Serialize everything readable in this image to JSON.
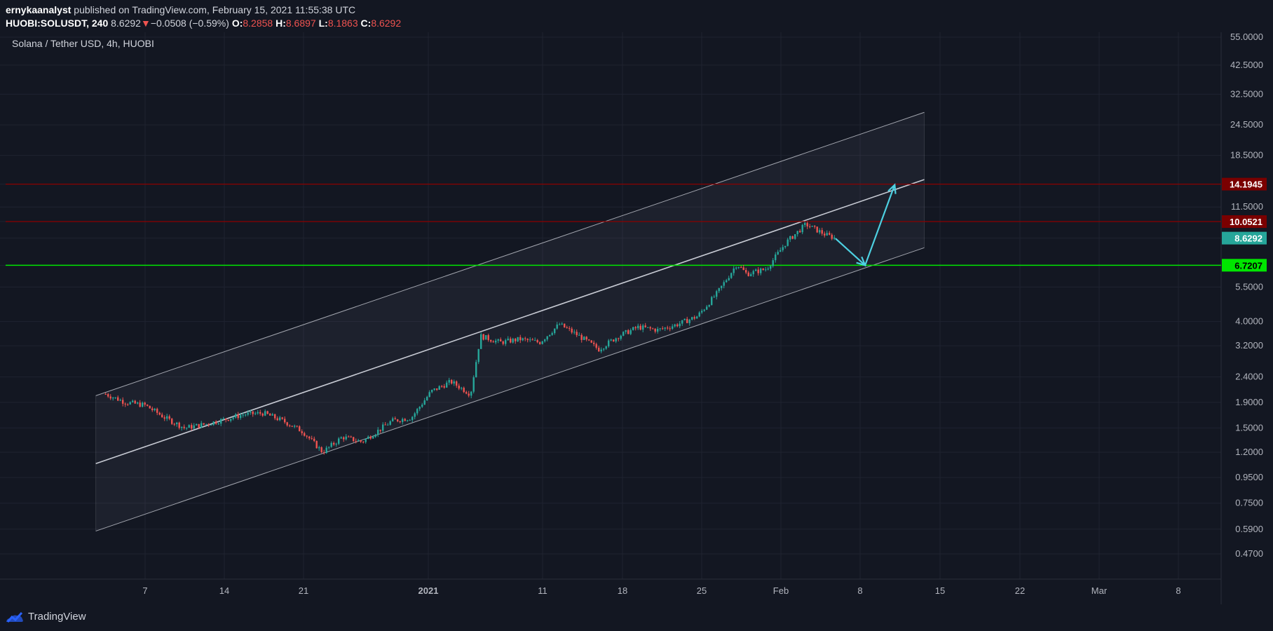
{
  "header": {
    "author": "ernykaanalyst",
    "published_text": "published on TradingView.com, February 15, 2021 11:55:38 UTC",
    "symbol": "HUOBI:SOLUSDT, 240",
    "last": "8.6292",
    "change": "−0.0508 (−0.59%)",
    "open_label": "O:",
    "open": "8.2858",
    "high_label": "H:",
    "high": "8.6897",
    "low_label": "L:",
    "low": "8.1863",
    "close_label": "C:",
    "close": "8.6292"
  },
  "footer": {
    "brand": "TradingView"
  },
  "colors": {
    "background": "#131722",
    "grid": "#1f2330",
    "up": "#26a69a",
    "down": "#ef5350",
    "channel": "#d1d4dc",
    "resistance": "#8b0000",
    "support": "#00e600",
    "arrow": "#4dd0e1"
  },
  "chart_data": {
    "type": "candlestick",
    "title": "Solana / Tether USD, 4h, HUOBI",
    "y_scale": "log",
    "ylim": [
      0.42,
      56
    ],
    "y_ticks": [
      "55.0000",
      "42.5000",
      "32.5000",
      "24.5000",
      "18.5000",
      "14.1945",
      "11.5000",
      "10.0521",
      "8.6292",
      "6.7207",
      "5.5000",
      "4.0000",
      "3.2000",
      "2.4000",
      "1.9000",
      "1.5000",
      "1.2000",
      "0.9500",
      "0.7500",
      "0.5900",
      "0.4700"
    ],
    "x_ticks": [
      "7",
      "14",
      "21",
      "2021",
      "11",
      "18",
      "25",
      "Feb",
      "8",
      "15",
      "22",
      "Mar",
      "8"
    ],
    "price_levels": [
      {
        "label": "14.1945",
        "value": 14.1945,
        "style": "resistance"
      },
      {
        "label": "10.0521",
        "value": 10.0521,
        "style": "resistance"
      },
      {
        "label": "8.6292",
        "value": 8.6292,
        "style": "last"
      },
      {
        "label": "6.7207",
        "value": 6.7207,
        "style": "support"
      }
    ],
    "price_path": [
      {
        "date": "2020-12-03",
        "close": 2.05
      },
      {
        "date": "2020-12-05",
        "close": 1.9
      },
      {
        "date": "2020-12-07",
        "close": 1.85
      },
      {
        "date": "2020-12-09",
        "close": 1.65
      },
      {
        "date": "2020-12-11",
        "close": 1.5
      },
      {
        "date": "2020-12-13",
        "close": 1.55
      },
      {
        "date": "2020-12-15",
        "close": 1.62
      },
      {
        "date": "2020-12-17",
        "close": 1.7
      },
      {
        "date": "2020-12-19",
        "close": 1.72
      },
      {
        "date": "2020-12-21",
        "close": 1.6
      },
      {
        "date": "2020-12-23",
        "close": 1.45
      },
      {
        "date": "2020-12-25",
        "close": 1.2
      },
      {
        "date": "2020-12-27",
        "close": 1.38
      },
      {
        "date": "2020-12-29",
        "close": 1.32
      },
      {
        "date": "2021-01-01",
        "close": 1.6
      },
      {
        "date": "2021-01-03",
        "close": 1.65
      },
      {
        "date": "2021-01-05",
        "close": 2.1
      },
      {
        "date": "2021-01-07",
        "close": 2.3
      },
      {
        "date": "2021-01-09",
        "close": 2.05
      },
      {
        "date": "2021-01-10",
        "close": 3.5
      },
      {
        "date": "2021-01-12",
        "close": 3.3
      },
      {
        "date": "2021-01-14",
        "close": 3.4
      },
      {
        "date": "2021-01-16",
        "close": 3.3
      },
      {
        "date": "2021-01-18",
        "close": 3.9
      },
      {
        "date": "2021-01-20",
        "close": 3.5
      },
      {
        "date": "2021-01-22",
        "close": 3.1
      },
      {
        "date": "2021-01-24",
        "close": 3.5
      },
      {
        "date": "2021-01-26",
        "close": 3.8
      },
      {
        "date": "2021-01-28",
        "close": 3.7
      },
      {
        "date": "2021-01-30",
        "close": 3.9
      },
      {
        "date": "2021-02-01",
        "close": 4.2
      },
      {
        "date": "2021-02-03",
        "close": 5.2
      },
      {
        "date": "2021-02-05",
        "close": 6.8
      },
      {
        "date": "2021-02-06",
        "close": 6.2
      },
      {
        "date": "2021-02-08",
        "close": 6.5
      },
      {
        "date": "2021-02-10",
        "close": 8.3
      },
      {
        "date": "2021-02-12",
        "close": 9.8
      },
      {
        "date": "2021-02-14",
        "close": 8.9
      },
      {
        "date": "2021-02-15",
        "close": 8.63
      }
    ],
    "channel": [
      {
        "line": "upper",
        "from": {
          "date": "2020-12-02",
          "value": 2.02
        },
        "to": {
          "date": "2021-02-24",
          "value": 27.5
        }
      },
      {
        "line": "middle",
        "from": {
          "date": "2020-12-02",
          "value": 1.08
        },
        "to": {
          "date": "2021-02-24",
          "value": 14.8
        }
      },
      {
        "line": "lower",
        "from": {
          "date": "2020-12-02",
          "value": 0.58
        },
        "to": {
          "date": "2021-02-24",
          "value": 7.9
        }
      }
    ],
    "projection": [
      {
        "date": "2021-02-15",
        "value": 8.6
      },
      {
        "date": "2021-02-18",
        "value": 6.72
      },
      {
        "date": "2021-02-21",
        "value": 14.1
      }
    ]
  }
}
